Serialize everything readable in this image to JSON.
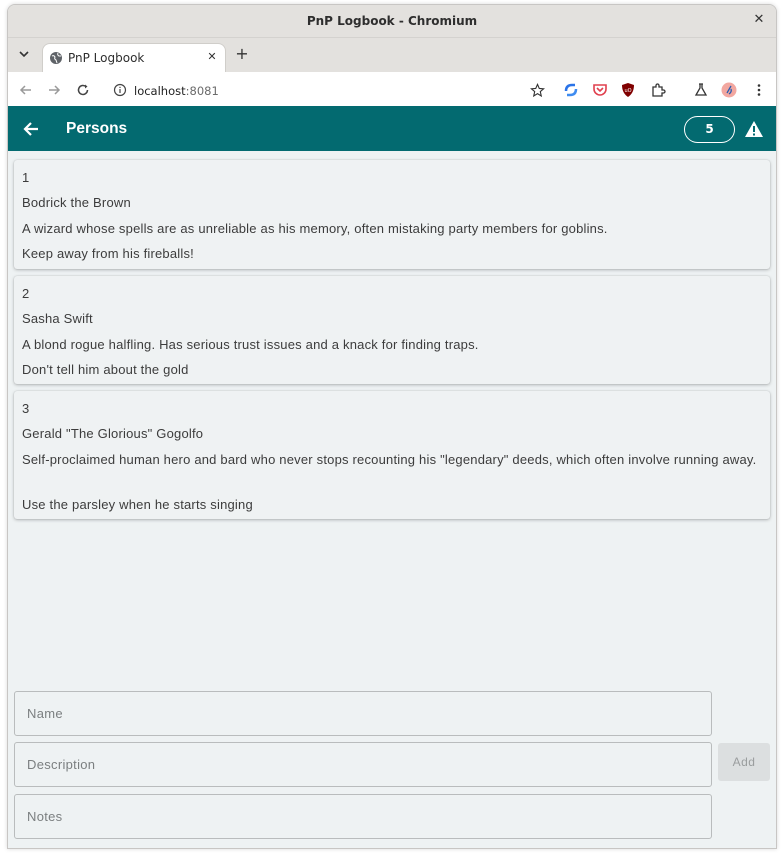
{
  "browser": {
    "window_title": "PnP Logbook - Chromium",
    "tab_title": "PnP Logbook",
    "url_host": "localhost",
    "url_port": ":8081"
  },
  "appbar": {
    "title": "Persons",
    "count": "5",
    "color": "#036a70"
  },
  "persons": [
    {
      "id": "1",
      "name": "Bodrick the Brown",
      "description": "A wizard whose spells are as unreliable as his memory, often mistaking party members for goblins.",
      "notes": "Keep away from his fireballs!"
    },
    {
      "id": "2",
      "name": "Sasha Swift",
      "description": "A blond rogue halfling. Has serious trust issues and a knack for finding traps.",
      "notes": "Don't tell him about the gold"
    },
    {
      "id": "3",
      "name": "Gerald \"The Glorious\" Gogolfo",
      "description": "Self-proclaimed human hero and bard who never stops recounting his \"legendary\" deeds, which often involve running away.",
      "notes": "Use the parsley when he starts singing"
    }
  ],
  "form": {
    "name_placeholder": "Name",
    "description_placeholder": "Description",
    "notes_placeholder": "Notes",
    "add_label": "Add"
  }
}
